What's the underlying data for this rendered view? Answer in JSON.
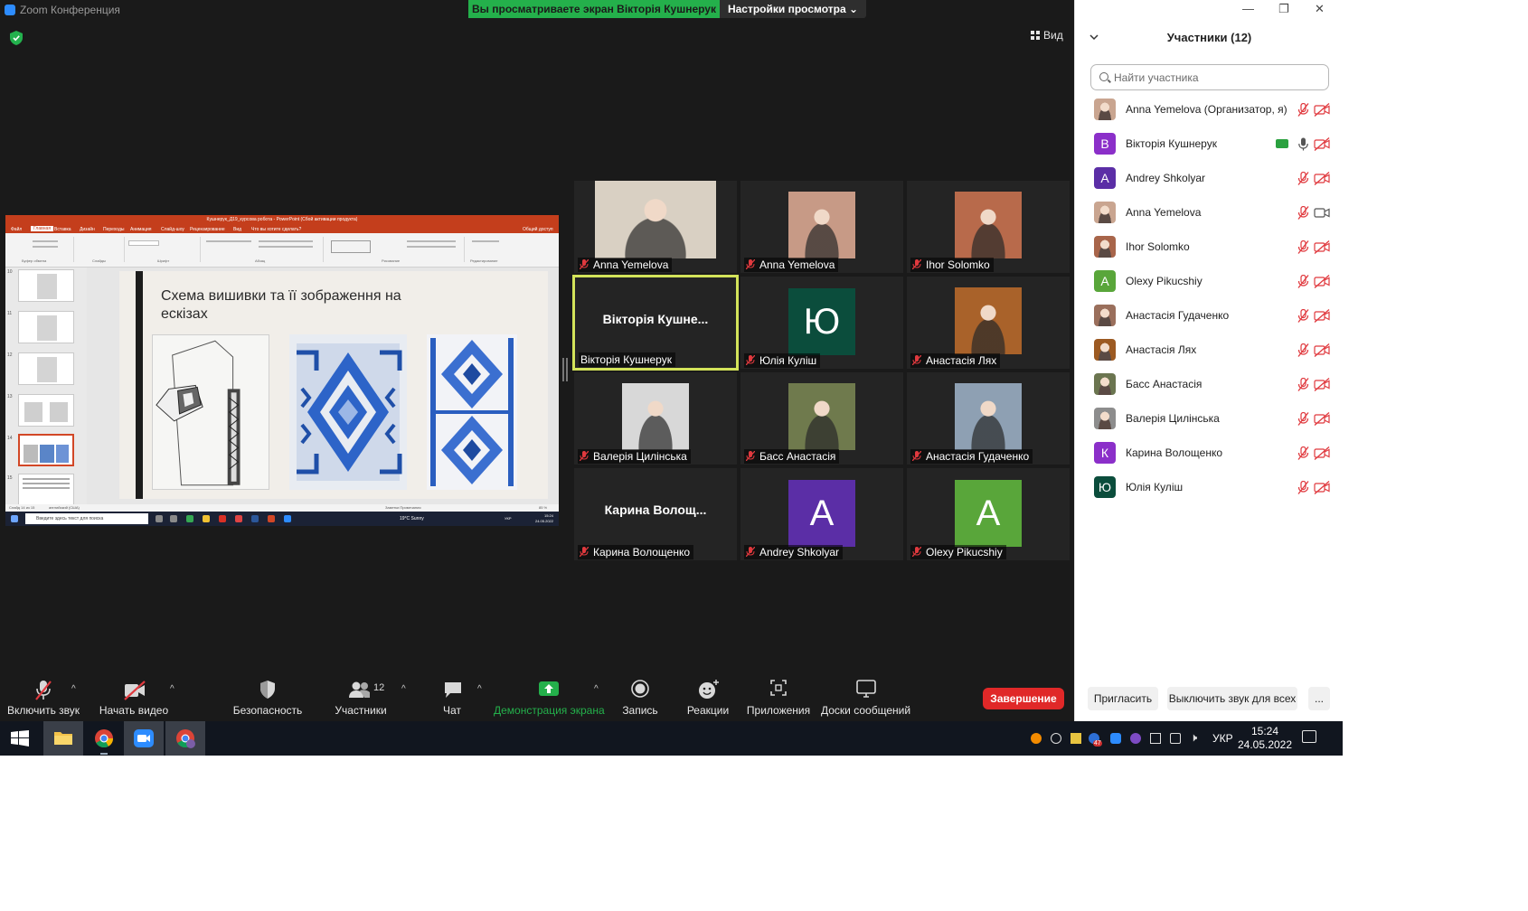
{
  "window": {
    "title": "Zoom Конференция"
  },
  "banner": {
    "viewing": "Вы просматриваете экран Вікторія Кушнерук",
    "view_settings": "Настройки просмотра"
  },
  "view_button": "Вид",
  "shared_screen": {
    "window_title": "Кушнерук_Д19_курсова робота - PowerPoint (Сбой активации продукта)",
    "tabs": [
      "Файл",
      "Главная",
      "Вставка",
      "Дизайн",
      "Переходы",
      "Анимация",
      "Слайд-шоу",
      "Рецензирование",
      "Вид",
      "Что вы хотите сделать?"
    ],
    "share": "Общий доступ",
    "ribbon_groups": [
      "Буфер обмена",
      "Слайды",
      "Шрифт",
      "Абзац",
      "Рисование",
      "Редактирование"
    ],
    "thumb_numbers": [
      "10",
      "11",
      "12",
      "13",
      "14",
      "15"
    ],
    "slide_title": "Схема вишивки та її зображення на ескізах",
    "status_left": "Слайд 14 из 15",
    "status_lang": "английский (США)",
    "status_right": "Заметки   Примечания",
    "zoom": "85 %",
    "mini_search": "Введите здесь текст для поиска",
    "weather": "19°C  Sunny",
    "mini_lang": "УКР",
    "mini_time": "15:24",
    "mini_date": "24.05.2022"
  },
  "gallery": [
    {
      "name": "Anna Yemelova",
      "kind": "photo",
      "color": "#d9d0c3",
      "muted": true
    },
    {
      "name": "Anna Yemelova",
      "kind": "photo",
      "color": "#c79a86",
      "muted": true
    },
    {
      "name": "Ihor Solomko",
      "kind": "photo",
      "color": "#b86a4b",
      "muted": true
    },
    {
      "name": "Вікторія Кушнерук",
      "kind": "text",
      "display": "Вікторія  Кушне...",
      "active": true,
      "muted": false
    },
    {
      "name": "Юлія Куліш",
      "kind": "avatar",
      "letter": "Ю",
      "color": "#0b4d3c",
      "muted": true
    },
    {
      "name": "Анастасія Лях",
      "kind": "photo",
      "color": "#a9622a",
      "muted": true
    },
    {
      "name": "Валерія Цилінська",
      "kind": "photo",
      "color": "#d8d8d8",
      "muted": true
    },
    {
      "name": "Басс Анастасія",
      "kind": "photo",
      "color": "#6f7a4d",
      "muted": true
    },
    {
      "name": "Анастасія Гудаченко",
      "kind": "photo",
      "color": "#8ea0b3",
      "muted": true
    },
    {
      "name": "Карина Волощенко",
      "kind": "text",
      "display": "Карина  Волощ...",
      "muted": true
    },
    {
      "name": "Andrey Shkolyar",
      "kind": "avatar",
      "letter": "A",
      "color": "#5b2ea6",
      "muted": true
    },
    {
      "name": "Olexy Pikucshiy",
      "kind": "avatar",
      "letter": "A",
      "color": "#59a63a",
      "muted": true
    }
  ],
  "participants_panel": {
    "title": "Участники (12)",
    "search_placeholder": "Найти участника",
    "participants": [
      {
        "name": "Anna Yemelova (Организатор, я)",
        "avatar": "photo",
        "color": "#c9a590",
        "mic": "off",
        "cam": "off"
      },
      {
        "name": "Вікторія Кушнерук",
        "avatar": "letter",
        "letter": "В",
        "color": "#8b2fc9",
        "mic": "on",
        "cam": "off",
        "sharing": true
      },
      {
        "name": "Andrey Shkolyar",
        "avatar": "letter",
        "letter": "A",
        "color": "#5b2ea6",
        "mic": "off",
        "cam": "off"
      },
      {
        "name": "Anna Yemelova",
        "avatar": "photo",
        "color": "#c9a590",
        "mic": "off",
        "cam": "on"
      },
      {
        "name": "Ihor Solomko",
        "avatar": "photo",
        "color": "#a8654a",
        "mic": "off",
        "cam": "off"
      },
      {
        "name": "Olexy Pikucshiy",
        "avatar": "letter",
        "letter": "A",
        "color": "#59a63a",
        "mic": "off",
        "cam": "off"
      },
      {
        "name": "Анастасія Гудаченко",
        "avatar": "photo",
        "color": "#9a6f5c",
        "mic": "off",
        "cam": "off"
      },
      {
        "name": "Анастасія Лях",
        "avatar": "photo",
        "color": "#9c5a22",
        "mic": "off",
        "cam": "off"
      },
      {
        "name": "Басс Анастасія",
        "avatar": "photo",
        "color": "#6b7550",
        "mic": "off",
        "cam": "off"
      },
      {
        "name": "Валерія Цилінська",
        "avatar": "photo",
        "color": "#8d8d8d",
        "mic": "off",
        "cam": "off"
      },
      {
        "name": "Карина Волощенко",
        "avatar": "letter",
        "letter": "К",
        "color": "#8b2fc9",
        "mic": "off",
        "cam": "off"
      },
      {
        "name": "Юлія Куліш",
        "avatar": "letter",
        "letter": "Ю",
        "color": "#0b4d3c",
        "mic": "off",
        "cam": "off"
      }
    ],
    "invite": "Пригласить",
    "mute_all": "Выключить звук для всех",
    "more": "..."
  },
  "toolbar": {
    "unmute": "Включить звук",
    "start_video": "Начать видео",
    "security": "Безопасность",
    "participants": "Участники",
    "participants_count": "12",
    "chat": "Чат",
    "share_screen": "Демонстрация экрана",
    "record": "Запись",
    "reactions": "Реакции",
    "apps": "Приложения",
    "whiteboards": "Доски сообщений",
    "end": "Завершение"
  },
  "taskbar": {
    "lang": "УКР",
    "time": "15:24",
    "date": "24.05.2022",
    "badge": "47"
  },
  "colors": {
    "share_green": "#24b04b",
    "end_red": "#e02828",
    "mute_red": "#e0393e",
    "accent": "#2d8cff"
  }
}
